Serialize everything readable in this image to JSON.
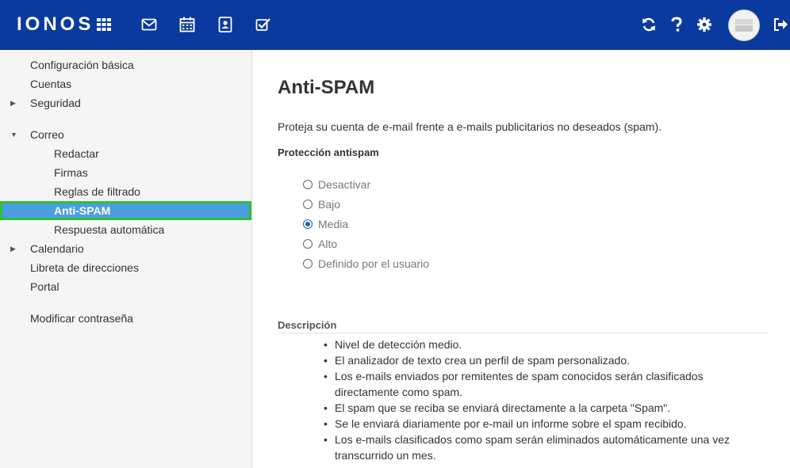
{
  "header": {
    "logo": "IONOS",
    "icons": [
      "apps-grid-icon",
      "mail-icon",
      "calendar-icon",
      "contacts-icon",
      "tasks-icon",
      "refresh-icon",
      "help-icon",
      "settings-icon",
      "logout-icon"
    ]
  },
  "sidebar": {
    "items": [
      {
        "label": "Configuración básica"
      },
      {
        "label": "Cuentas"
      },
      {
        "label": "Seguridad"
      },
      {
        "label": "Correo"
      },
      {
        "label": "Redactar"
      },
      {
        "label": "Firmas"
      },
      {
        "label": "Reglas de filtrado"
      },
      {
        "label": "Anti-SPAM"
      },
      {
        "label": "Respuesta automática"
      },
      {
        "label": "Calendario"
      },
      {
        "label": "Libreta de direcciones"
      },
      {
        "label": "Portal"
      },
      {
        "label": "Modificar contraseña"
      }
    ],
    "active": "Anti-SPAM"
  },
  "main": {
    "title": "Anti-SPAM",
    "intro": "Proteja su cuenta de e-mail frente a e-mails publicitarios no deseados (spam).",
    "protection_title": "Protección antispam",
    "options": [
      {
        "label": "Desactivar"
      },
      {
        "label": "Bajo"
      },
      {
        "label": "Media"
      },
      {
        "label": "Alto"
      },
      {
        "label": "Definido por el usuario"
      }
    ],
    "selected_option": "Media",
    "description_title": "Descripción",
    "description_items": [
      "Nivel de detección medio.",
      "El analizador de texto crea un perfil de spam personalizado.",
      "Los e-mails enviados por remitentes de spam conocidos serán clasificados directamente como spam.",
      "El spam que se reciba se enviará directamente a la carpeta \"Spam\".",
      "Se le enviará diariamente por e-mail un informe sobre el spam recibido.",
      "Los e-mails clasificados como spam serán eliminados automáticamente una vez transcurrido un mes."
    ]
  },
  "colors": {
    "header_bg": "#0a3a9e",
    "active_item_bg": "#4a9ee0",
    "active_item_outline": "#2fbf3a",
    "radio_checked": "#1a5fbf"
  }
}
